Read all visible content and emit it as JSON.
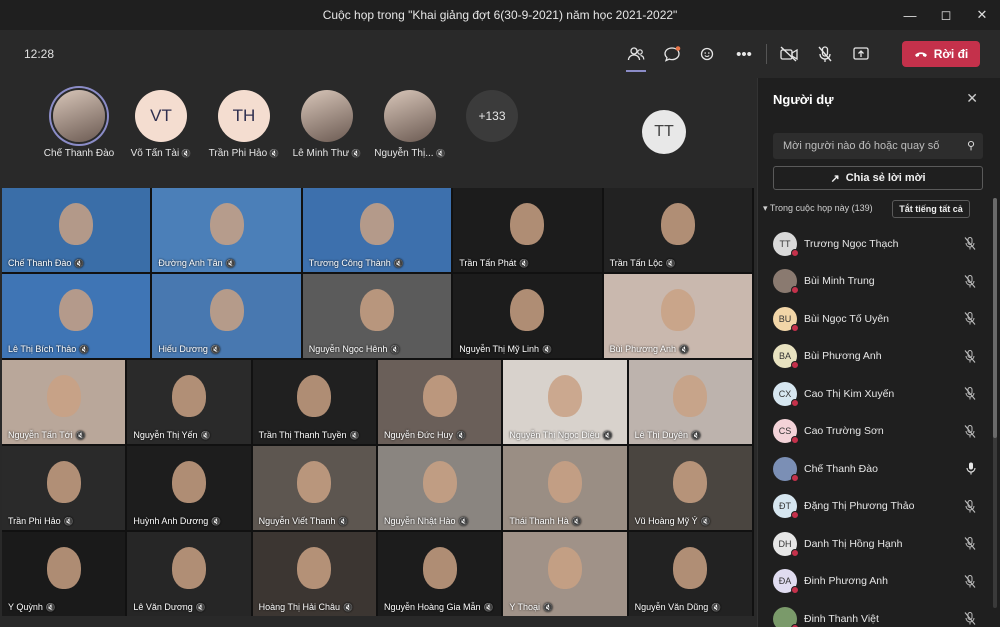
{
  "window": {
    "title": "Cuộc họp trong \"Khai giảng đợt 6(30-9-2021) năm học 2021-2022\"",
    "minimize_icon": "minimize-icon",
    "maximize_icon": "maximize-icon",
    "close_icon": "close-icon"
  },
  "toolbar": {
    "time": "12:28",
    "leave_label": "Rời đi",
    "icons": [
      "people-icon",
      "chat-icon",
      "reactions-icon",
      "more-icon",
      "camera-off-icon",
      "mic-off-icon",
      "share-screen-icon"
    ]
  },
  "avatars": [
    {
      "name": "Chế Thanh Đào",
      "initials": "",
      "photo": true,
      "ring": true,
      "muted": false
    },
    {
      "name": "Võ Tấn Tài",
      "initials": "VT",
      "photo": false,
      "muted": true
    },
    {
      "name": "Trần Phi Hảo",
      "initials": "TH",
      "photo": false,
      "muted": true
    },
    {
      "name": "Lê Minh Thư",
      "initials": "",
      "photo": true,
      "muted": true
    },
    {
      "name": "Nguyễn Thị...",
      "initials": "",
      "photo": true,
      "muted": true
    },
    {
      "name": "",
      "initials": "+133",
      "photo": false,
      "more": true
    }
  ],
  "tt_avatar": "TT",
  "tiles": [
    "Chế Thanh Đào",
    "Đường Anh Tân",
    "Trương Công Thành",
    "Trần Tấn Phát",
    "Trần Tấn Lộc",
    "Lê Thị Bích Thảo",
    "Hiếu Dương",
    "Nguyễn Ngọc Hênh",
    "Nguyễn Thị Mỹ Linh",
    "Bùi Phương Anh",
    "Nguyễn Tấn Tới",
    "Nguyễn Thị Yến",
    "Trần Thị Thanh Tuyền",
    "Nguyễn Đức Huy",
    "Nguyễn Thị Ngọc Diệu",
    "Lê Thị Duyên",
    "Trần Phi Hảo",
    "Huỳnh Anh Dương",
    "Nguyễn Viết Thanh",
    "Nguyễn Nhật Hào",
    "Thái Thanh Hà",
    "Vũ Hoàng Mỹ Ý",
    "Y Quỳnh",
    "Lê Văn Dương",
    "Hoàng Thị Hải Châu",
    "Nguyễn Hoàng Gia Mẫn",
    "Y Thoại",
    "Nguyễn Văn Dũng"
  ],
  "panel": {
    "title": "Người dự",
    "search_placeholder": "Mời người nào đó hoặc quay số",
    "share_label": "Chia sẻ lời mời",
    "section_label": "Trong cuộc họp này (139)",
    "mute_all_label": "Tắt tiếng tất cả",
    "participants": [
      {
        "initials": "TT",
        "name": "Trương Ngọc Thạch",
        "color": "#d9d9d9",
        "mic": "mic-off-icon"
      },
      {
        "initials": "",
        "name": "Bùi Minh Trung",
        "color": "#8a7a70",
        "mic": "mic-off-icon"
      },
      {
        "initials": "BU",
        "name": "Bùi Ngọc Tố Uyên",
        "color": "#f2d6a8",
        "mic": "mic-off-icon"
      },
      {
        "initials": "BA",
        "name": "Bùi Phương Anh",
        "color": "#e8e2c0",
        "mic": "mic-off-icon"
      },
      {
        "initials": "CX",
        "name": "Cao Thị Kim Xuyến",
        "color": "#d6e6f0",
        "mic": "mic-off-icon"
      },
      {
        "initials": "CS",
        "name": "Cao Trường Sơn",
        "color": "#f3d3d8",
        "mic": "mic-off-icon"
      },
      {
        "initials": "",
        "name": "Chế Thanh Đào",
        "color": "#7b8fb5",
        "mic": "mic-on-icon"
      },
      {
        "initials": "ĐT",
        "name": "Đặng Thị Phương Thảo",
        "color": "#d6e6f0",
        "mic": "mic-off-icon"
      },
      {
        "initials": "DH",
        "name": "Danh Thị Hồng Hạnh",
        "color": "#e6e6e6",
        "mic": "mic-off-icon"
      },
      {
        "initials": "ĐA",
        "name": "Đinh Phương Anh",
        "color": "#e0dcf0",
        "mic": "mic-off-icon"
      },
      {
        "initials": "",
        "name": "Đinh Thanh Việt",
        "color": "#7a9a6a",
        "mic": "mic-off-icon"
      }
    ]
  }
}
